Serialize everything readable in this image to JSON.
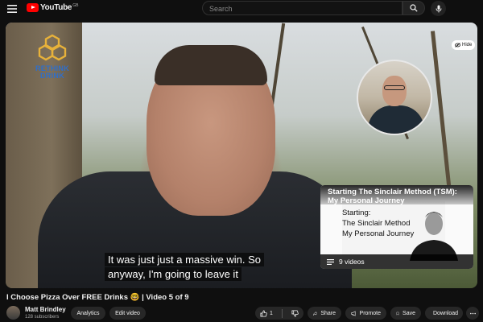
{
  "header": {
    "logo_text": "YouTube",
    "logo_country": "GB",
    "search_placeholder": "Search"
  },
  "player": {
    "brand": [
      "RETHINK",
      "DRINK"
    ],
    "hide_label": "Hide",
    "subtitle_lines": [
      "It was just just a massive win. So",
      "anyway, I'm going to leave it"
    ],
    "endscreen_playlist": {
      "title_lines": [
        "Starting The Sinclair Method (TSM):",
        "My Personal Journey"
      ],
      "thumb_lines": [
        "Starting:",
        "The Sinclair Method",
        "My Personal Journey"
      ],
      "count_label": "9 videos"
    }
  },
  "video": {
    "title": "I Choose Pizza Over FREE Drinks 🤓 | Video 5 of 9"
  },
  "channel": {
    "name": "Matt Brindley",
    "subscribers": "128 subscribers"
  },
  "actions": {
    "analytics": "Analytics",
    "edit_video": "Edit video",
    "like_count": "1",
    "share": "Share",
    "promote": "Promote",
    "save": "Save",
    "download": "Download"
  },
  "colors": {
    "brand_red": "#ff0000",
    "rethink_blue": "#2f6ec9",
    "rethink_gold": "#e8b23a"
  }
}
